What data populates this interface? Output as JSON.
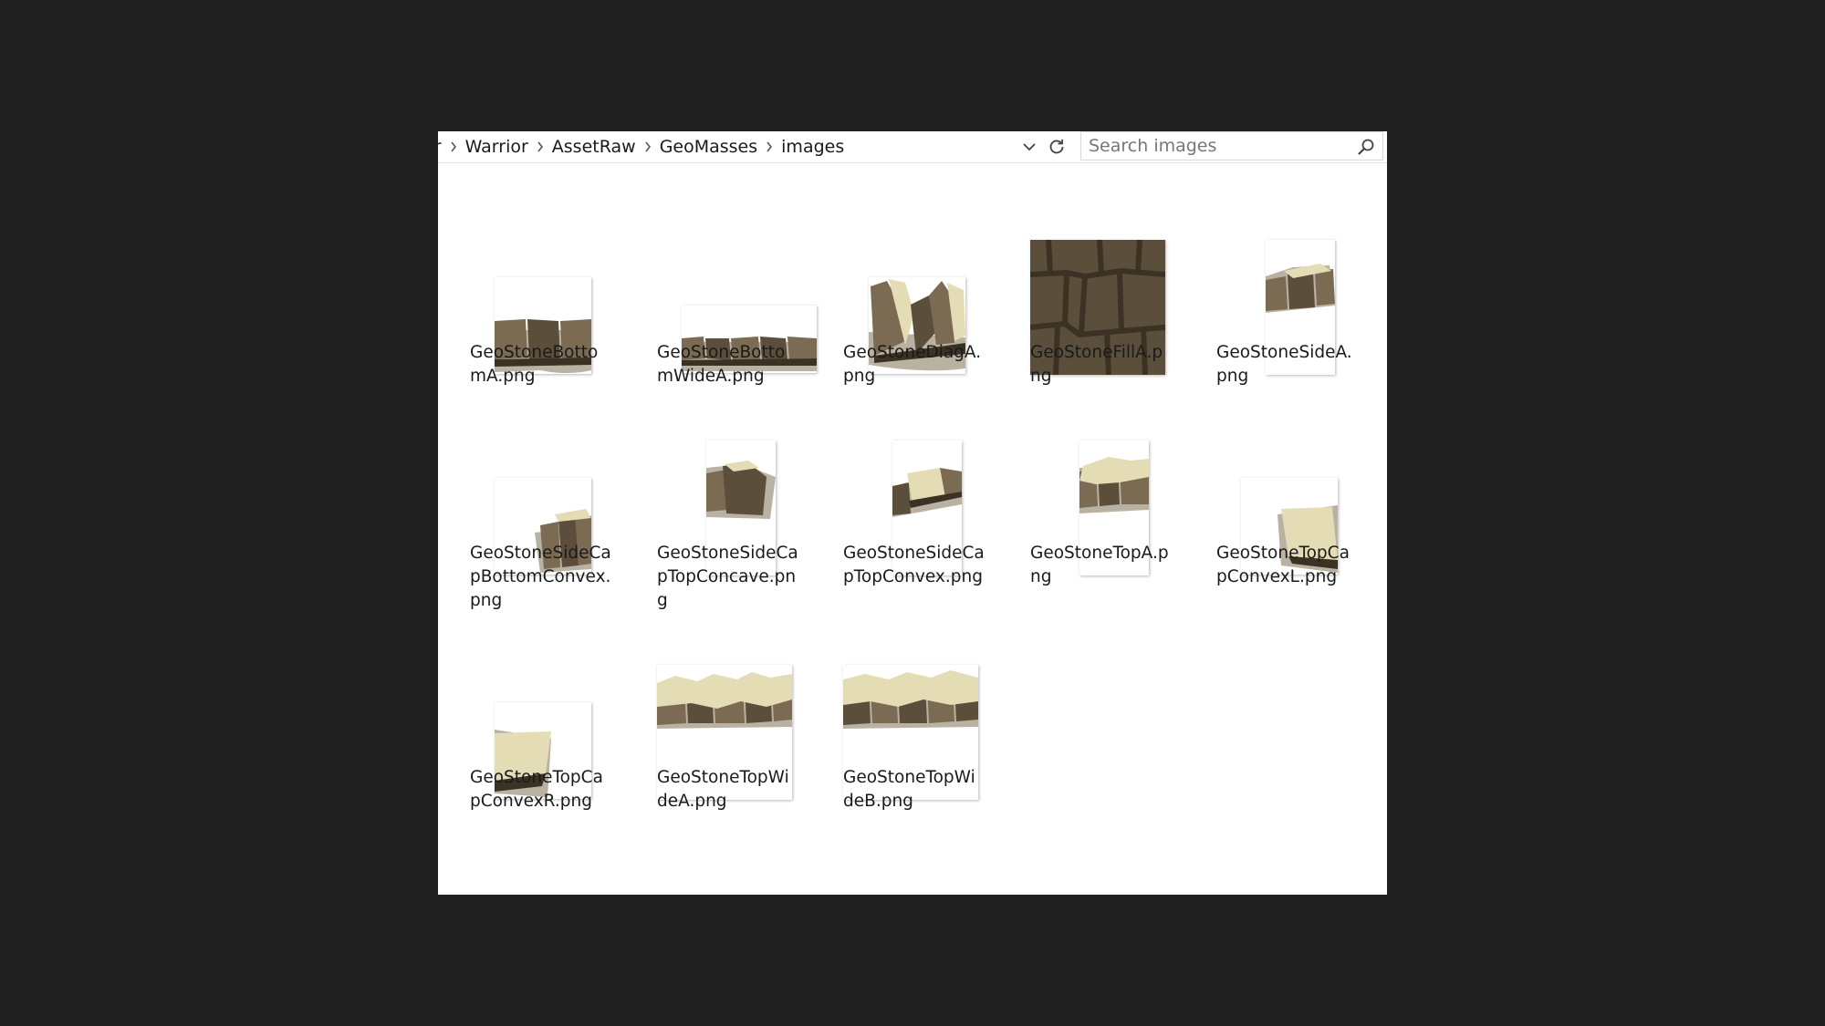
{
  "breadcrumb": {
    "items": [
      "der",
      "Warrior",
      "AssetRaw",
      "GeoMasses",
      "images"
    ]
  },
  "search": {
    "placeholder": "Search images"
  },
  "icons": {
    "separator": "chevron-right-icon",
    "dropdown": "chevron-down-icon",
    "refresh": "refresh-icon",
    "search": "search-icon"
  },
  "colors": {
    "background": "#202020",
    "window": "#ffffff",
    "stone_dark": "#5b4f3c",
    "stone_mid": "#7a6b52",
    "stone_light": "#e4dcb4",
    "stone_shadow": "#3c3224"
  },
  "files": [
    {
      "name": "GeoStoneBottomA.png",
      "kind": "bottom"
    },
    {
      "name": "GeoStoneBottomWideA.png",
      "kind": "bottomwide"
    },
    {
      "name": "GeoStoneDiagA.png",
      "kind": "diag"
    },
    {
      "name": "GeoStoneFillA.png",
      "kind": "fill"
    },
    {
      "name": "GeoStoneSideA.png",
      "kind": "side"
    },
    {
      "name": "GeoStoneSideCapBottomConvex.png",
      "kind": "sidecapbottom"
    },
    {
      "name": "GeoStoneSideCapTopConcave.png",
      "kind": "sidecaptopconcave"
    },
    {
      "name": "GeoStoneSideCapTopConvex.png",
      "kind": "sidecaptopconvex"
    },
    {
      "name": "GeoStoneTopA.png",
      "kind": "top"
    },
    {
      "name": "GeoStoneTopCapConvexL.png",
      "kind": "topcapl"
    },
    {
      "name": "GeoStoneTopCapConvexR.png",
      "kind": "topcapr"
    },
    {
      "name": "GeoStoneTopWideA.png",
      "kind": "topwidea"
    },
    {
      "name": "GeoStoneTopWideB.png",
      "kind": "topwideb"
    }
  ]
}
